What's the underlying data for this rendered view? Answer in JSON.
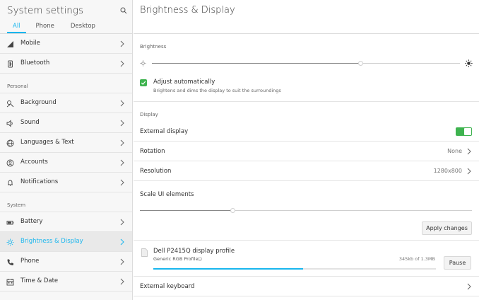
{
  "sidebar": {
    "title": "System settings",
    "tabs": [
      "All",
      "Phone",
      "Desktop"
    ],
    "items": [
      {
        "label": "Mobile",
        "icon": "signal-icon"
      },
      {
        "label": "Bluetooth",
        "icon": "bluetooth-icon"
      }
    ],
    "personal_label": "Personal",
    "personal_items": [
      {
        "label": "Background",
        "icon": "background-icon"
      },
      {
        "label": "Sound",
        "icon": "speaker-icon"
      },
      {
        "label": "Languages & Text",
        "icon": "globe-icon"
      },
      {
        "label": "Accounts",
        "icon": "accounts-icon"
      },
      {
        "label": "Notifications",
        "icon": "bell-icon"
      }
    ],
    "system_label": "System",
    "system_items": [
      {
        "label": "Battery",
        "icon": "battery-icon"
      },
      {
        "label": "Brightness & Display",
        "icon": "sun-icon",
        "selected": true
      },
      {
        "label": "Phone",
        "icon": "phone-icon"
      },
      {
        "label": "Time & Date",
        "icon": "calendar-icon"
      }
    ]
  },
  "main": {
    "title": "Brightness & Display",
    "brightness": {
      "label": "Brightness",
      "level": 0.68
    },
    "adjust": {
      "title": "Adjust automatically",
      "subtitle": "Brightens and dims the display to suit the surroundings",
      "checked": true
    },
    "display": {
      "label": "Display",
      "external_display": "External display",
      "external_display_on": true,
      "rotation_label": "Rotation",
      "rotation_value": "None",
      "resolution_label": "Resolution",
      "resolution_value": "1280x800",
      "scale_label": "Scale UI elements",
      "scale_level": 0.28,
      "apply_button": "Apply changes"
    },
    "profile": {
      "title": "Dell P2415Q display profile",
      "subtitle": "Generic RGB Profile",
      "progress_text": "345kb of 1.3MB",
      "progress": 0.53,
      "pause_button": "Pause"
    },
    "external_keyboard": "External keyboard"
  },
  "colors": {
    "accent": "#19b6ee",
    "toggle_on": "#3eb34f",
    "sidebar_bg": "#f7f7f7",
    "selected_bg": "#e9e9e9"
  }
}
